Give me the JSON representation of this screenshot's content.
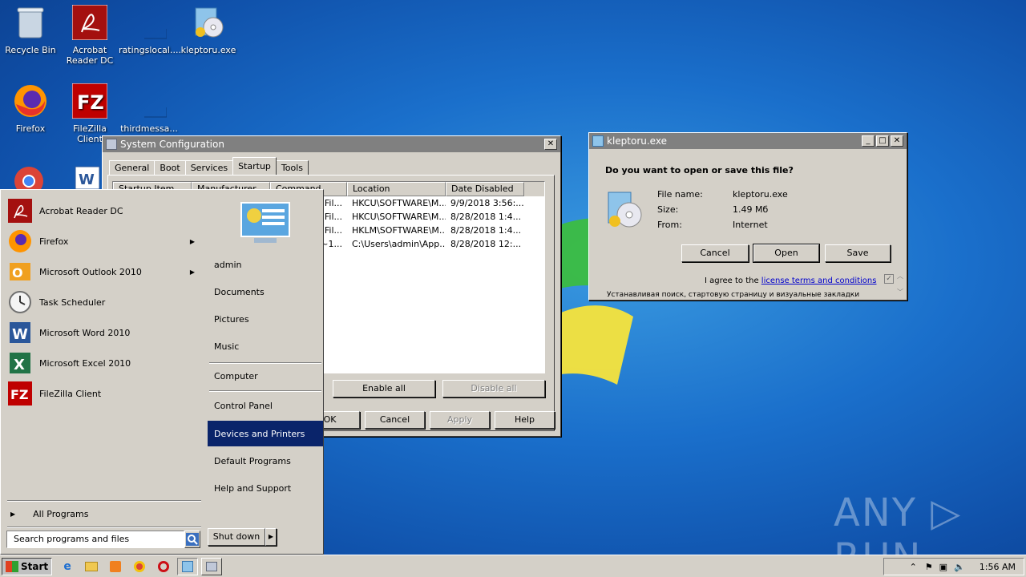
{
  "desktop": {
    "icons": [
      {
        "label": "Recycle Bin"
      },
      {
        "label": "Acrobat\nReader DC"
      },
      {
        "label": "ratingslocal...."
      },
      {
        "label": "kleptoru.exe"
      },
      {
        "label": "Firefox"
      },
      {
        "label": "FileZilla Client"
      },
      {
        "label": "thirdmessa..."
      }
    ],
    "watermark": "ANY ▷ RUN"
  },
  "sysconfig": {
    "title": "System Configuration",
    "tabs": [
      "General",
      "Boot",
      "Services",
      "Startup",
      "Tools"
    ],
    "active_tab": "Startup",
    "columns": [
      "Startup Item",
      "Manufacturer",
      "Command",
      "Location",
      "Date Disabled"
    ],
    "rows": [
      {
        "command": "n Fil...",
        "location": "HKCU\\SOFTWARE\\M...",
        "date": "9/9/2018 3:56:..."
      },
      {
        "command": "n Fil...",
        "location": "HKCU\\SOFTWARE\\M...",
        "date": "8/28/2018 1:4..."
      },
      {
        "command": "n Fil...",
        "location": "HKLM\\SOFTWARE\\M...",
        "date": "8/28/2018 1:4..."
      },
      {
        "command": "~1...",
        "location": "C:\\Users\\admin\\App...",
        "date": "8/28/2018 12:..."
      }
    ],
    "enable_all": "Enable all",
    "disable_all": "Disable all",
    "ok": "OK",
    "cancel": "Cancel",
    "apply": "Apply",
    "help": "Help"
  },
  "download": {
    "title": "kleptoru.exe",
    "question": "Do you want to open or save this file?",
    "name_label": "File name:",
    "name_value": "kleptoru.exe",
    "size_label": "Size:",
    "size_value": "1.49 Мб",
    "from_label": "From:",
    "from_value": "Internet",
    "cancel": "Cancel",
    "open": "Open",
    "save": "Save",
    "agree_prefix": "I agree to the",
    "agree_link": "license terms and conditions",
    "install_text": "Устанавливая поиск, стартовую страницу и визуальные закладки"
  },
  "startmenu": {
    "programs": [
      {
        "label": "Acrobat Reader DC",
        "icon": "acrobat-icon",
        "arrow": false
      },
      {
        "label": "Firefox",
        "icon": "firefox-icon",
        "arrow": true
      },
      {
        "label": "Microsoft Outlook 2010",
        "icon": "outlook-icon",
        "arrow": true
      },
      {
        "label": "Task Scheduler",
        "icon": "clock-icon",
        "arrow": false
      },
      {
        "label": "Microsoft Word 2010",
        "icon": "word-icon",
        "arrow": false
      },
      {
        "label": "Microsoft Excel 2010",
        "icon": "excel-icon",
        "arrow": false
      },
      {
        "label": "FileZilla Client",
        "icon": "filezilla-icon",
        "arrow": false
      }
    ],
    "all_programs": "All Programs",
    "search_placeholder": "Search programs and files",
    "right_items": [
      "admin",
      "Documents",
      "Pictures",
      "Music",
      "Computer",
      "Control Panel",
      "Devices and Printers",
      "Default Programs",
      "Help and Support"
    ],
    "selected_item": "Devices and Printers",
    "shutdown": "Shut down"
  },
  "taskbar": {
    "start_label": "Start",
    "clock": "1:56 AM"
  }
}
